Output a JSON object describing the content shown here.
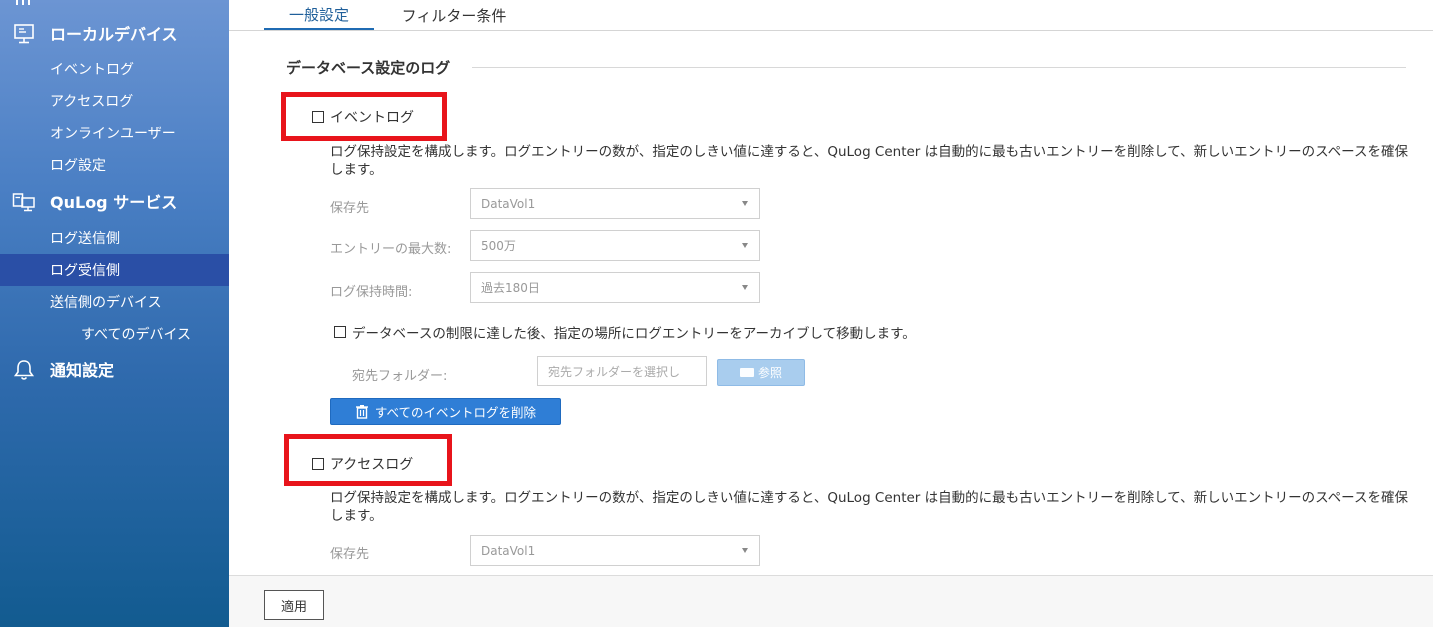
{
  "sidebar": {
    "local_devices": {
      "label": "ローカルデバイス",
      "items": [
        "イベントログ",
        "アクセスログ",
        "オンラインユーザー",
        "ログ設定"
      ]
    },
    "qulog_service": {
      "label": "QuLog サービス",
      "items": [
        "ログ送信側",
        "ログ受信側",
        "送信側のデバイス",
        "すべてのデバイス"
      ],
      "active": "ログ受信側"
    },
    "notifications": {
      "label": "通知設定"
    }
  },
  "tabs": [
    {
      "label": "一般設定",
      "active": true
    },
    {
      "label": "フィルター条件",
      "active": false
    }
  ],
  "section_title": "データベース設定のログ",
  "event_log": {
    "checkbox_label": "イベントログ",
    "description": "ログ保持設定を構成します。ログエントリーの数が、指定のしきい値に達すると、QuLog Center は自動的に最も古いエントリーを削除して、新しいエントリーのスペースを確保します。",
    "fields": {
      "destination": {
        "label": "保存先",
        "value": "DataVol1"
      },
      "max_entries": {
        "label": "エントリーの最大数:",
        "value": "500万"
      },
      "retention": {
        "label": "ログ保持時間:",
        "value": "過去180日"
      }
    },
    "archive_checkbox": "データベースの制限に達した後、指定の場所にログエントリーをアーカイブして移動します。",
    "dest_folder": {
      "label": "宛先フォルダー:",
      "placeholder": "宛先フォルダーを選択し"
    },
    "browse_label": "参照",
    "delete_label": "すべてのイベントログを削除"
  },
  "access_log": {
    "checkbox_label": "アクセスログ",
    "description": "ログ保持設定を構成します。ログエントリーの数が、指定のしきい値に達すると、QuLog Center は自動的に最も古いエントリーを削除して、新しいエントリーのスペースを確保します。",
    "fields": {
      "destination": {
        "label": "保存先",
        "value": "DataVol1"
      }
    }
  },
  "apply_label": "適用",
  "colors": {
    "sidebar_active": "#2a4fa6",
    "highlight": "#e8141b",
    "primary_button": "#2f7ed6"
  }
}
